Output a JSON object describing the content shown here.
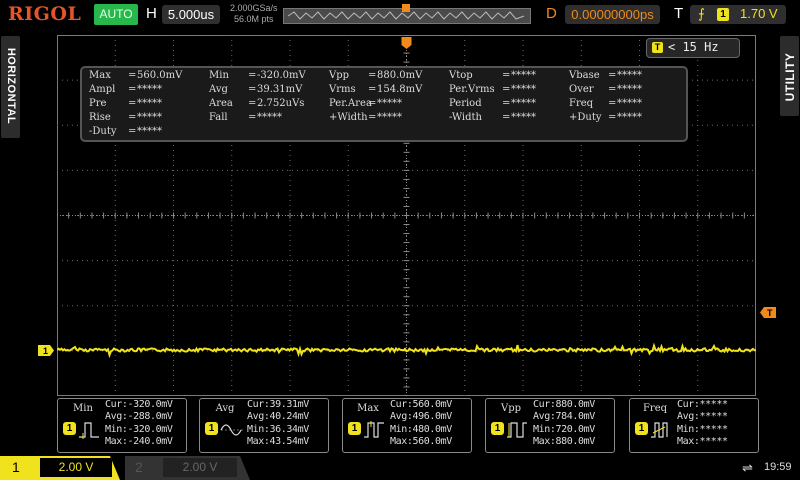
{
  "topbar": {
    "logo": "RIGOL",
    "mode_button": "AUTO",
    "horizontal_label": "H",
    "timebase": "5.000us",
    "sample_rate": "2.000GSa/s",
    "memory_depth": "56.0M pts",
    "delay_label": "D",
    "delay_value": "0.00000000ps",
    "trigger_label": "T",
    "trigger_source": "1",
    "trigger_level": "1.70 V"
  },
  "side_tabs": {
    "left": "HORIZONTAL",
    "right": "UTILITY"
  },
  "frequency_counter": {
    "channel": "T",
    "value": "< 15 Hz"
  },
  "measurements": {
    "rows": [
      [
        {
          "label": "Max",
          "value": "560.0mV"
        },
        {
          "label": "Min",
          "value": "-320.0mV"
        },
        {
          "label": "Vpp",
          "value": "880.0mV"
        },
        {
          "label": "Vtop",
          "value": "*****"
        },
        {
          "label": "Vbase",
          "value": "*****"
        }
      ],
      [
        {
          "label": "Ampl",
          "value": "*****"
        },
        {
          "label": "Avg",
          "value": "39.31mV"
        },
        {
          "label": "Vrms",
          "value": "154.8mV"
        },
        {
          "label": "Per.Vrms",
          "value": "*****"
        },
        {
          "label": "Over",
          "value": "*****"
        }
      ],
      [
        {
          "label": "Pre",
          "value": "*****"
        },
        {
          "label": "Area",
          "value": "2.752uVs"
        },
        {
          "label": "Per.Area",
          "value": "*****"
        },
        {
          "label": "Period",
          "value": "*****"
        },
        {
          "label": "Freq",
          "value": "*****"
        }
      ],
      [
        {
          "label": "Rise",
          "value": "*****"
        },
        {
          "label": "Fall",
          "value": "*****"
        },
        {
          "label": "+Width",
          "value": "*****"
        },
        {
          "label": "-Width",
          "value": "*****"
        },
        {
          "label": "+Duty",
          "value": "*****"
        }
      ],
      [
        {
          "label": "-Duty",
          "value": "*****"
        }
      ]
    ]
  },
  "stats": [
    {
      "name": "Min",
      "channel": "1",
      "cur": "Cur:-320.0mV",
      "avg": "Avg:-288.0mV",
      "min": "Min:-320.0mV",
      "max": "Max:-240.0mV"
    },
    {
      "name": "Avg",
      "channel": "1",
      "cur": "Cur:39.31mV",
      "avg": "Avg:40.24mV",
      "min": "Min:36.34mV",
      "max": "Max:43.54mV"
    },
    {
      "name": "Max",
      "channel": "1",
      "cur": "Cur:560.0mV",
      "avg": "Avg:496.0mV",
      "min": "Min:480.0mV",
      "max": "Max:560.0mV"
    },
    {
      "name": "Vpp",
      "channel": "1",
      "cur": "Cur:880.0mV",
      "avg": "Avg:784.0mV",
      "min": "Min:720.0mV",
      "max": "Max:880.0mV"
    },
    {
      "name": "Freq",
      "channel": "1",
      "cur": "Cur:*****",
      "avg": "Avg:*****",
      "min": "Min:*****",
      "max": "Max:*****"
    }
  ],
  "channels": {
    "ch1": {
      "number": "1",
      "scale": "2.00 V",
      "marker": "1"
    },
    "ch2": {
      "number": "2",
      "scale": "2.00 V"
    }
  },
  "trigger_marker": "T",
  "clock": "19:59",
  "colors": {
    "ch1": "#f0e21c",
    "trigger": "#f08a1a",
    "auto": "#26b84b",
    "logo": "#e8542a"
  }
}
